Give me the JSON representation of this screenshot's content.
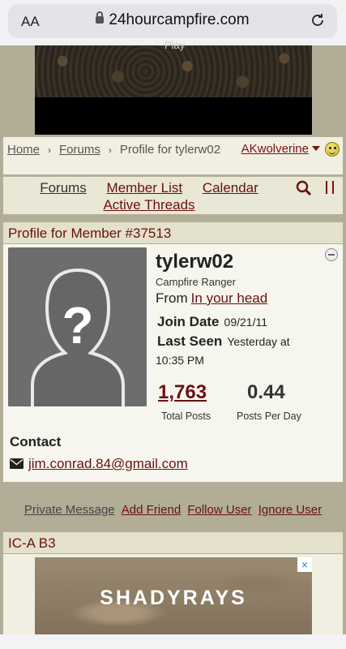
{
  "browser": {
    "aa_label": "AA",
    "url": "24hourcampfire.com"
  },
  "banner": {
    "play_text": "Play"
  },
  "breadcrumb": {
    "home": "Home",
    "forums": "Forums",
    "current": "Profile for tylerw02",
    "separator": "›"
  },
  "user_menu": {
    "username": "AKwolverine"
  },
  "nav": {
    "forums": "Forums",
    "member_list": "Member List",
    "calendar": "Calendar",
    "active_threads": "Active Threads"
  },
  "profile": {
    "header": "Profile for Member #37513",
    "username": "tylerw02",
    "rank": "Campfire Ranger",
    "from_label": "From",
    "from_value": "In your head",
    "join_label": "Join Date",
    "join_value": "09/21/11",
    "seen_label": "Last Seen",
    "seen_value_1": "Yesterday at",
    "seen_value_2": "10:35 PM",
    "total_posts": "1,763",
    "total_posts_label": "Total Posts",
    "posts_per_day": "0.44",
    "posts_per_day_label": "Posts Per Day",
    "contact_heading": "Contact",
    "email": "jim.conrad.84@gmail.com"
  },
  "actions": {
    "private_message": "Private Message",
    "add_friend": "Add Friend",
    "follow_user": "Follow User",
    "ignore_user": "Ignore User"
  },
  "ad_section": {
    "header": "IC-A B3",
    "ad_text": "SHADYRAYS",
    "close": "×"
  },
  "colors": {
    "accent": "#6b1010",
    "page_bg": "#b1ad96",
    "panel_bg": "#f0efe2"
  }
}
